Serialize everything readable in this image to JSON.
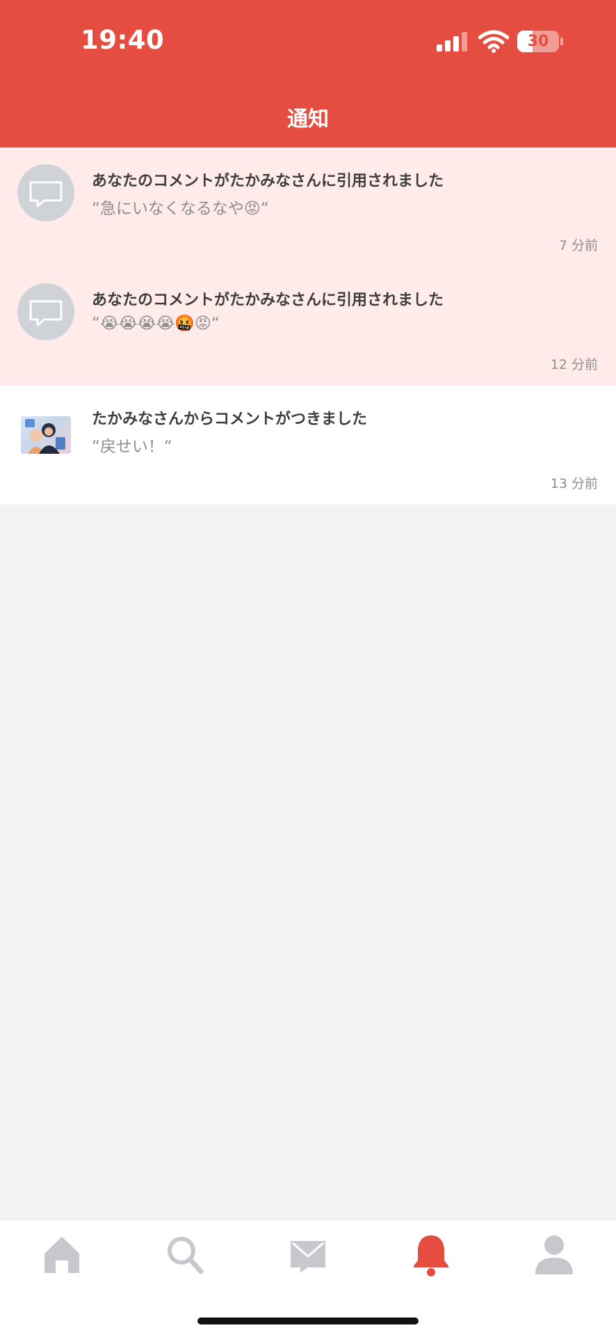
{
  "status_bar": {
    "time": "19:40",
    "battery": "30"
  },
  "header": {
    "title": "通知"
  },
  "notifications": [
    {
      "title": "あなたのコメントがたかみなさんに引用されました",
      "body": "“急にいなくなるなや😡“",
      "time": "7 分前",
      "icon": "comment-bubble-icon",
      "unread": true
    },
    {
      "title": "あなたのコメントがたかみなさんに引用されました",
      "body": "“😭😭😭😭🤬😡“",
      "time": "12 分前",
      "icon": "comment-bubble-icon",
      "unread": true
    },
    {
      "title": "たかみなさんからコメントがつきました",
      "body": "“戻せい！“",
      "time": "13 分前",
      "icon": "user-photo-thumbnail",
      "unread": false
    }
  ],
  "tab_bar": {
    "items": [
      {
        "icon": "home-icon",
        "active": false
      },
      {
        "icon": "search-icon",
        "active": false
      },
      {
        "icon": "mail-icon",
        "active": false
      },
      {
        "icon": "bell-icon",
        "active": true
      },
      {
        "icon": "profile-icon",
        "active": false
      }
    ]
  },
  "colors": {
    "accent": "#e44d3f",
    "unread_bg": "#ffebea",
    "inactive_icon": "#c6c8cd",
    "background": "#f2f2f2"
  }
}
